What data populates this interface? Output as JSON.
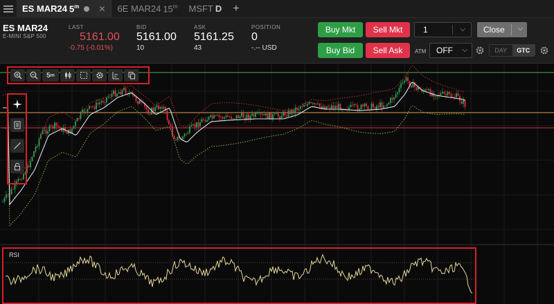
{
  "tabs": [
    {
      "symbol": "ES MAR24",
      "timeframe": "5",
      "timeframe_unit": "m",
      "active": true
    },
    {
      "symbol": "6E MAR24",
      "timeframe": "15",
      "timeframe_unit": "m",
      "active": false
    },
    {
      "symbol": "MSFT",
      "timeframe": "D",
      "timeframe_unit": "",
      "active": false
    }
  ],
  "add_tab_label": "+",
  "quote": {
    "symbol": "ES MAR24",
    "description": "E-MINI S&P 500",
    "last_label": "LAST",
    "last_value": "5161.00",
    "last_change": "-0.75 (-0.01%)",
    "bid_label": "BID",
    "bid_value": "5161.00",
    "bid_size": "10",
    "ask_label": "ASK",
    "ask_value": "5161.25",
    "ask_size": "43",
    "position_label": "POSITION",
    "position_value": "0",
    "position_pnl": "-.-- USD"
  },
  "order_buttons": {
    "buy_mkt": "Buy Mkt",
    "sell_mkt": "Sell Mkt",
    "buy_bid": "Buy Bid",
    "sell_ask": "Sell Ask"
  },
  "quantity": "1",
  "close_label": "Close",
  "atm_label": "ATM",
  "atm_value": "OFF",
  "tif": {
    "day": "DAY",
    "gtc": "GTC",
    "selected": "GTC"
  },
  "chart_toolbar": {
    "timeframe": "5",
    "timeframe_unit": "m"
  },
  "indicator_label": "RSI",
  "colors": {
    "buy": "#2e9e46",
    "sell": "#e0334a",
    "highlight_box": "#d8202a",
    "candle_up": "#26a65b",
    "candle_down": "#e03040",
    "rsi_line": "#e8d89a",
    "ma_line": "#d8e4ea",
    "band_upper": "#c03030",
    "band_lower": "#8ab84a"
  }
}
